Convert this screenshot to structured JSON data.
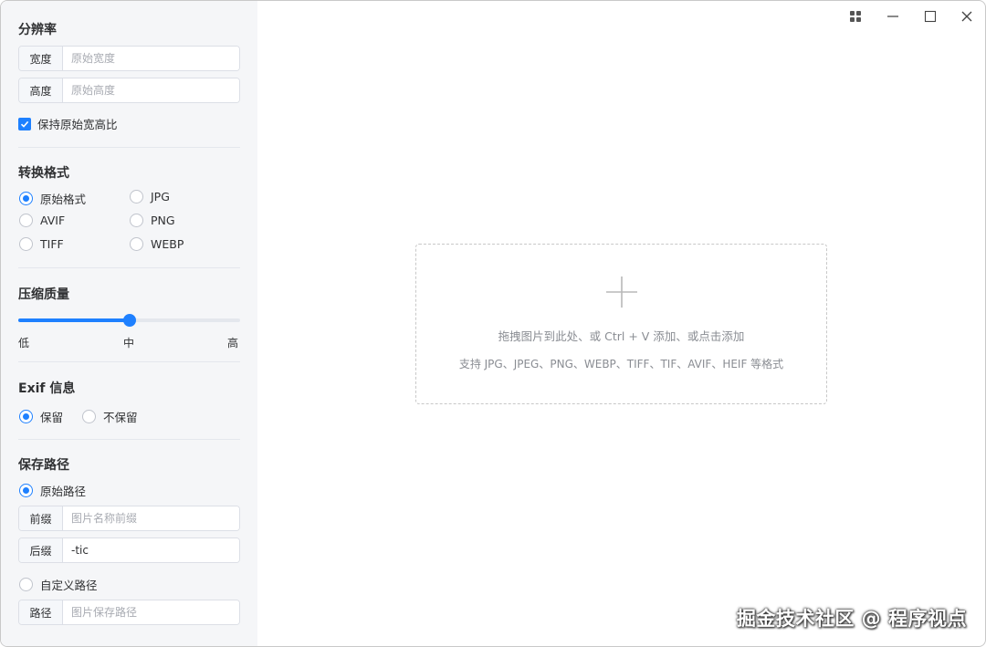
{
  "sidebar": {
    "resolution": {
      "title": "分辨率",
      "width_label": "宽度",
      "width_placeholder": "原始宽度",
      "height_label": "高度",
      "height_placeholder": "原始高度",
      "keep_ratio_label": "保持原始宽高比",
      "keep_ratio_checked": true
    },
    "format": {
      "title": "转换格式",
      "options": [
        "原始格式",
        "JPG",
        "AVIF",
        "PNG",
        "TIFF",
        "WEBP"
      ],
      "selected": "原始格式"
    },
    "quality": {
      "title": "压缩质量",
      "low": "低",
      "mid": "中",
      "high": "高",
      "value": 0.5
    },
    "exif": {
      "title": "Exif 信息",
      "keep": "保留",
      "discard": "不保留",
      "selected": "保留"
    },
    "save_path": {
      "title": "保存路径",
      "original_label": "原始路径",
      "prefix_label": "前缀",
      "prefix_placeholder": "图片名称前缀",
      "suffix_label": "后缀",
      "suffix_value": "-tic",
      "custom_label": "自定义路径",
      "path_label": "路径",
      "path_placeholder": "图片保存路径",
      "selected": "原始路径"
    }
  },
  "dropzone": {
    "line1": "拖拽图片到此处、或 Ctrl + V 添加、或点击添加",
    "line2": "支持 JPG、JPEG、PNG、WEBP、TIFF、TIF、AVIF、HEIF 等格式"
  },
  "titlebar": {
    "icons": [
      "grid-icon",
      "minimize-icon",
      "maximize-icon",
      "close-icon"
    ]
  },
  "watermark": "掘金技术社区 @ 程序视点",
  "colors": {
    "accent": "#1e80ff",
    "sidebar_bg": "#f5f6f8"
  }
}
